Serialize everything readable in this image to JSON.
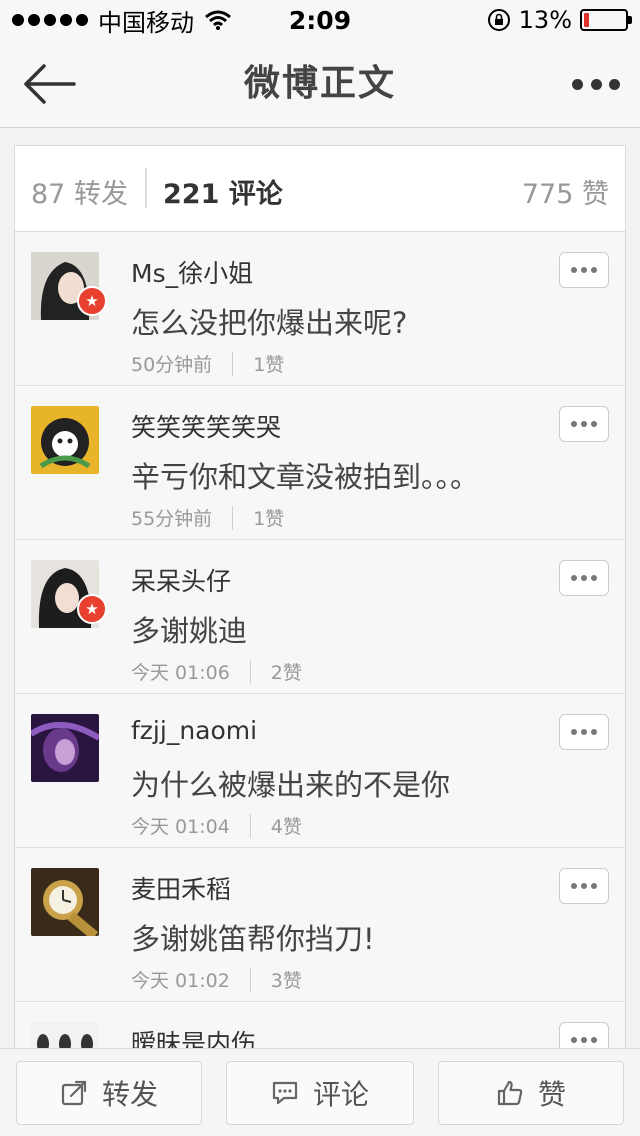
{
  "status_bar": {
    "carrier": "中国移动",
    "time": "2:09",
    "battery": "13%",
    "battery_level": 0.13
  },
  "nav": {
    "title": "微博正文"
  },
  "tabs": {
    "repost": "87 转发",
    "comment": "221 评论",
    "like": "775 赞"
  },
  "comments": [
    {
      "user": "Ms_徐小姐",
      "text": "怎么没把你爆出来呢?",
      "time": "50分钟前",
      "likes": "1赞",
      "verified": true
    },
    {
      "user": "笑笑笑笑笑哭",
      "text": "辛亏你和文章没被拍到。。。",
      "time": "55分钟前",
      "likes": "1赞",
      "verified": false
    },
    {
      "user": "呆呆头仔",
      "text": "多谢姚迪",
      "time": "今天 01:06",
      "likes": "2赞",
      "verified": true
    },
    {
      "user": "fzjj_naomi",
      "text": "为什么被爆出来的不是你",
      "time": "今天 01:04",
      "likes": "4赞",
      "verified": false
    },
    {
      "user": "麦田禾稻",
      "text": "多谢姚笛帮你挡刀!",
      "time": "今天 01:02",
      "likes": "3赞",
      "verified": false
    },
    {
      "user": "暧昧是内伤",
      "text": "",
      "time": "",
      "likes": "",
      "verified": false
    }
  ],
  "toolbar": {
    "repost": "转发",
    "comment": "评论",
    "like": "赞"
  },
  "colors": {
    "accent_badge": "#e8412f",
    "battery_low": "#e0312c"
  }
}
